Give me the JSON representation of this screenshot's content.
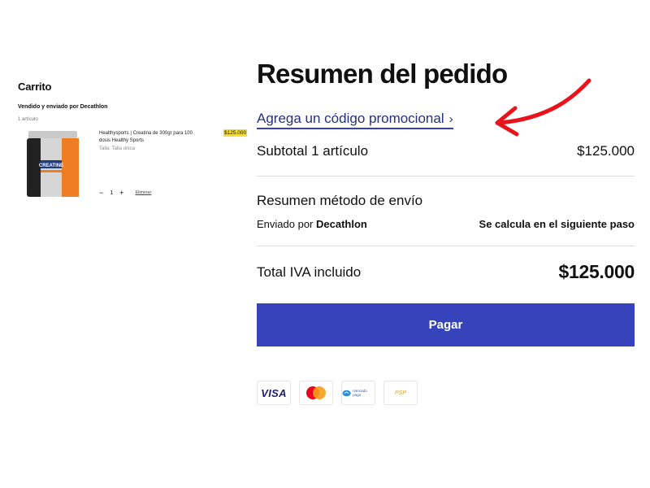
{
  "cart": {
    "title": "Carrito",
    "sold_by": "Vendido y enviado por Decathlon",
    "item_count": "1 artículo",
    "product": {
      "name": "Healthysports | Creatina de 300gr para 100 dosis Healthy Sports",
      "size": "Talla: Talla única",
      "price": "$125.000",
      "quantity": "1",
      "minus_icon": "minus-icon",
      "plus_icon": "plus-icon",
      "remove_label": "Eliminar",
      "jar_label": "CREATINE"
    }
  },
  "summary": {
    "title": "Resumen del pedido",
    "promo_label": "Agrega un código promocional",
    "promo_icon": "chevron-right-icon",
    "subtotal_label": "Subtotal 1 artículo",
    "subtotal_value": "$125.000",
    "shipping_title": "Resumen método de envío",
    "shipped_by_prefix": "Enviado por ",
    "shipped_by_name": "Decathlon",
    "shipping_note": "Se calcula en el siguiente paso",
    "total_label": "Total IVA incluido",
    "total_value": "$125.000",
    "pay_label": "Pagar",
    "pay_color": "#3643ba"
  },
  "payment_methods": {
    "visa": "VISA",
    "mastercard_icon": "mastercard-icon",
    "mercadopago_text": "mercado pago",
    "pse_text": "PSP"
  },
  "annotation": {
    "arrow_color": "#e8141c",
    "arrow_icon": "red-arrow-icon"
  }
}
